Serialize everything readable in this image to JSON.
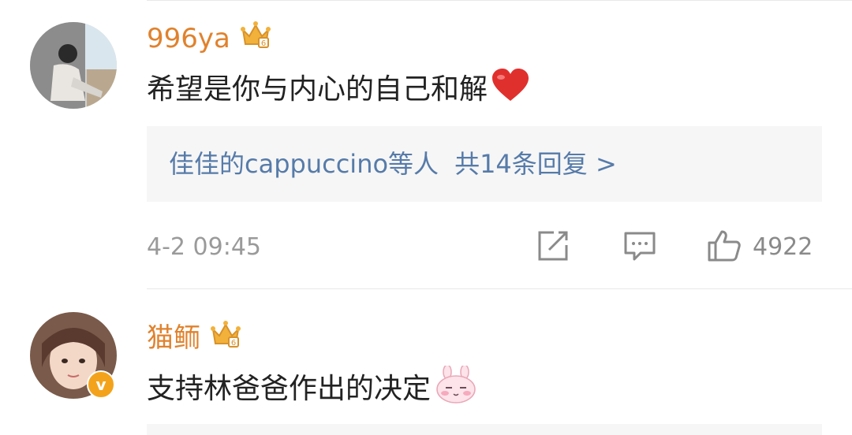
{
  "comments": [
    {
      "username": "996ya",
      "text": "希望是你与内心的自己和解",
      "reaction_emoji": "heart",
      "reply_summary": {
        "users": "佳佳的cappuccino等人",
        "count_label": "共14条回复 >"
      },
      "time": "4-2 09:45",
      "likes": "4922",
      "icons": [
        "crown-badge-icon",
        "share-icon",
        "comment-icon",
        "like-icon"
      ]
    },
    {
      "username": "猫鲕",
      "text": "支持林爸爸作出的决定",
      "reaction_emoji": "shy-bunny",
      "verified": true,
      "icons": [
        "crown-badge-icon",
        "verified-v-icon"
      ]
    }
  ],
  "colors": {
    "username": "#e0822d",
    "link": "#567ba9",
    "meta": "#9a9a9a",
    "heart": "#e0302e",
    "verified": "#f3a31b"
  }
}
